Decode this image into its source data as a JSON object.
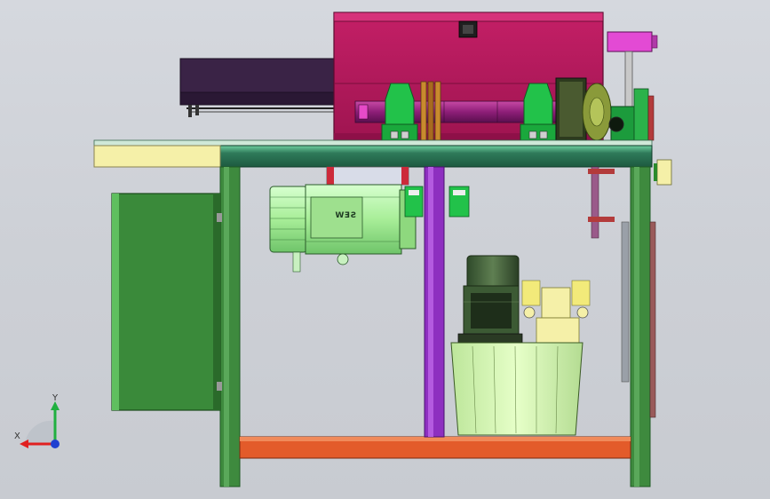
{
  "viewport": {
    "background_top": "#d5d8de",
    "background_bottom": "#c8cbd1"
  },
  "colors": {
    "frame_green": "#3e8a3e",
    "frame_green_dark": "#1f5a24",
    "table_top": "#2f7a5a",
    "table_top_light": "#5fbf8f",
    "gearbox_magenta": "#b6195e",
    "gearbox_magenta_dark": "#7a0f3c",
    "purple_column": "#8e2fc0",
    "orange_beam": "#e35b2a",
    "motor_lime": "#b6f5a8",
    "tank_lime": "#d8f5b6",
    "cover_dark": "#3a2346",
    "cream_plate": "#f5f0a8",
    "bearing_green": "#22c24a"
  },
  "motor": {
    "nameplate_text": "SEW"
  },
  "triad": {
    "y_label": "Y",
    "x_label": "X",
    "y_color": "#20b040",
    "x_color": "#e02020",
    "z_color": "#2040d0"
  }
}
